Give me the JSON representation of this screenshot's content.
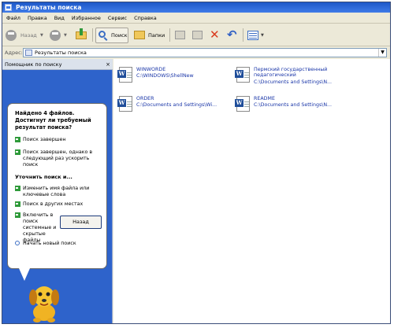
{
  "window": {
    "title": "Результаты поиска"
  },
  "menu": [
    "Файл",
    "Правка",
    "Вид",
    "Избранное",
    "Сервис",
    "Справка"
  ],
  "toolbar": {
    "back": "Назад",
    "search": "Поиск",
    "folders": "Папки"
  },
  "address": {
    "label": "Адрес:",
    "value": "Результаты поиска"
  },
  "left_pane": {
    "header": "Помощник по поиску",
    "close": "×",
    "bubble_title": "Найдено 4 файлов. Достигнут ли требуемый результат поиска?",
    "items_a": [
      "Поиск завершен",
      "Поиск завершен, однако в следующий раз ускорить поиск"
    ],
    "refine_title": "Уточнить поиск и...",
    "items_b": [
      "Изменить имя файла или ключевые слова",
      "Поиск в других местах",
      "Включить в поиск системные и скрытые файлы"
    ],
    "new_search": "Начать новый поиск",
    "back_button": "Назад"
  },
  "files": [
    {
      "name": "WINWORDE",
      "path": "C:\\WINDOWS\\ShellNew"
    },
    {
      "name": "Пермский государственный педагогический",
      "path": "C:\\Documents and Settings\\N..."
    },
    {
      "name": "ORDER",
      "path": "C:\\Documents and Settings\\Wi..."
    },
    {
      "name": "README",
      "path": "C:\\Documents and Settings\\N..."
    }
  ],
  "colors": {
    "title_bar": "#3f7be8",
    "left_pane": "#2e63cb",
    "link": "#1a36a8",
    "arrow_green": "#2f9a3a",
    "word_blue": "#1f4e9a"
  },
  "icons": [
    "back-arrow-icon",
    "forward-arrow-icon",
    "up-folder-icon",
    "search-icon",
    "folders-icon",
    "move-to-icon",
    "copy-to-icon",
    "delete-icon",
    "undo-icon",
    "views-icon",
    "word-document-icon",
    "dog-assistant-icon"
  ]
}
